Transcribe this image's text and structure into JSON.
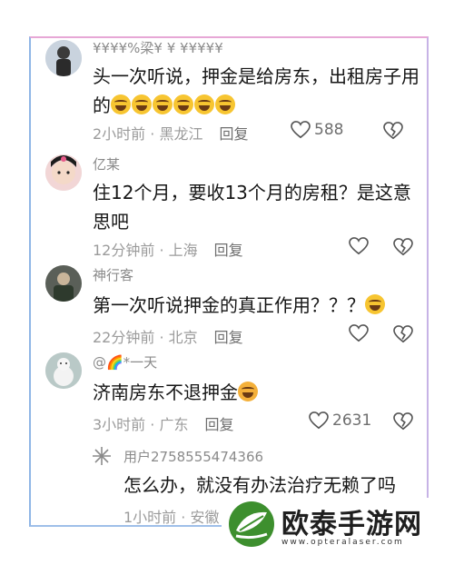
{
  "comments": [
    {
      "username": "¥¥¥¥%梁¥ ¥ ¥¥¥¥¥",
      "text": "头一次听说，押金是给房东，出租房子用的",
      "time_location": "2小时前 · 黑龙江",
      "reply": "回复",
      "likes": "588"
    },
    {
      "username": "亿某",
      "text": "住12个月，要收13个月的房租？是这意思吧",
      "time_location": "12分钟前 · 上海",
      "reply": "回复",
      "likes": ""
    },
    {
      "username": "神行客",
      "text": "第一次听说押金的真正作用？？？",
      "time_location": "22分钟前 · 北京",
      "reply": "回复",
      "likes": ""
    },
    {
      "username": "@🌈*一天",
      "text": "济南房东不退押金",
      "time_location": "3小时前 · 广东",
      "reply": "回复",
      "likes": "2631"
    },
    {
      "username": "用户2758555474366",
      "text": "怎么办，就没有办法治疗无赖了吗",
      "time_location": "1小时前 · 安徽",
      "reply": "",
      "likes": ""
    }
  ],
  "watermark": {
    "title": "欧泰手游网",
    "url": "www.opteralaser.com"
  },
  "colors": {
    "accent_green": "#3d8f2e",
    "emoji_yellow": "#f7c531"
  },
  "icons": [
    "heart-icon",
    "dislike-heart-icon",
    "laughing-emoji",
    "shocked-emoji"
  ]
}
